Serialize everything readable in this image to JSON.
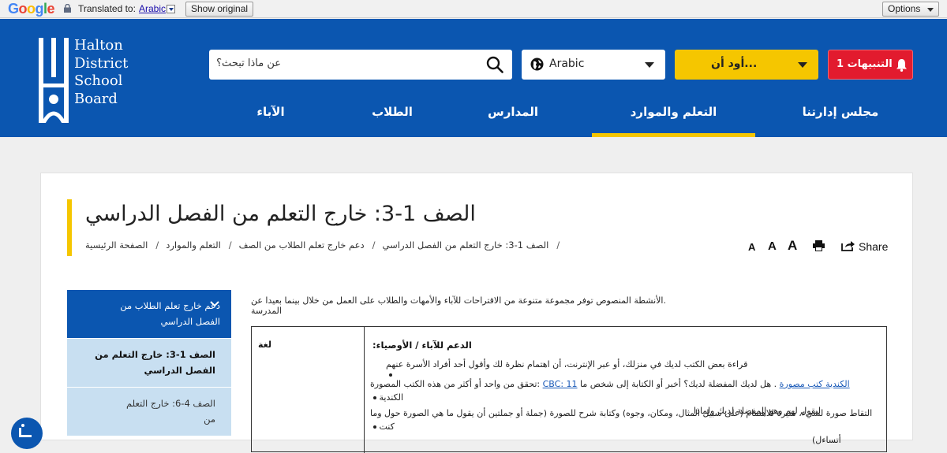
{
  "translate_bar": {
    "google_logo": "Google",
    "translated_to_label": "Translated to:",
    "language_link": "Arabic",
    "show_original_button": "Show original",
    "options_button": "Options"
  },
  "header": {
    "logo_lines": [
      "Halton",
      "District",
      "School",
      "Board"
    ],
    "search_placeholder": "عن ماذا تبحث؟",
    "language_select": "Arabic",
    "i_want_to": "...أود أن",
    "alerts_label": "التنبيهات 1",
    "nav": [
      "الآباء",
      "الطلاب",
      "المدارس",
      "التعلم والموارد",
      "مجلس إدارتنا"
    ],
    "active_nav_index": 3
  },
  "page": {
    "title": "الصف 1-3: خارج التعلم من الفصل الدراسي",
    "breadcrumbs": [
      "الصفحة الرئيسية",
      "التعلم والموارد",
      "دعم خارج تعلم الطلاب من الصف",
      "الصف 1-3: خارج التعلم من الفصل الدراسي"
    ],
    "breadcrumb_separator": "/",
    "text_size_small": "A",
    "text_size_medium": "A",
    "text_size_large": "A",
    "share_label": "Share"
  },
  "sidebar": {
    "items": [
      "دعم خارج تعلم الطلاب من الفصل الدراسي",
      "الصف 1-3: خارج التعلم من الفصل الدراسي",
      "الصف 4-6: خارج التعلم من"
    ]
  },
  "content": {
    "intro": ".الأنشطة المنصوص توفر مجموعة متنوعة من الاقتراحات للآباء والأمهات والطلاب على العمل من خلال بينما بعيدا عن المدرسة",
    "table": {
      "left_header": "لغة",
      "right_header": "الدعم للآباء / الأوصياء:",
      "bullet1": "قراءة بعض الكتب لديك في منزلك، أو عبر الإنترنت، أن اهتمام نظرة لك وأقول أحد أفراد الأسرة عنهم",
      "bullet2_link1": "الكندية كتب مصورة",
      "bullet2_mid": " . هل لديك المفضلة لديك؟ أخبر أو الكتابة إلى شخص ما ",
      "bullet2_link2": "CBC: 11",
      "bullet2_end": " :تحقق من واحد أو أكثر من هذه الكتب المصورة الكندية",
      "bullet2_line2": "ليقول لهم وهو المفضلة لديك ولماذا",
      "bullet3": "التقاط صورة لشيء، مثيرة للاهتمام (على سبيل المثال، ومكان، وجوه) وكتابة شرح للصورة (جملة أو جملتين أن يقول ما هي الصورة حول وما كنت",
      "bullet3_line2": "أتساءل)"
    }
  },
  "colors": {
    "header_blue": "#0b56b0",
    "accent_yellow": "#f5c600",
    "alert_red": "#e21b2e",
    "sidebar_light": "#c8dff1"
  }
}
